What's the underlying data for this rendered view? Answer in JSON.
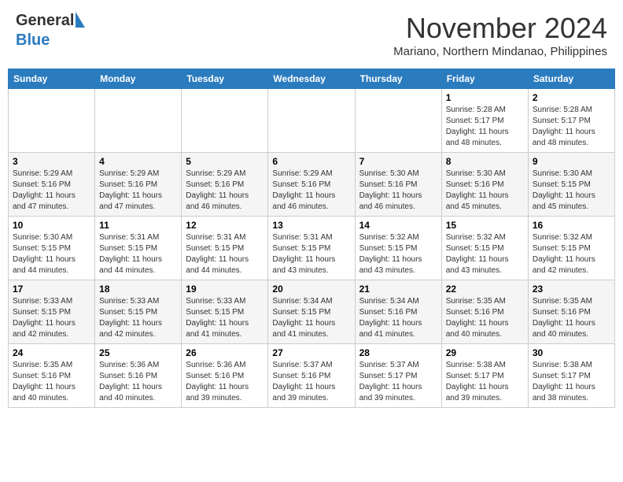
{
  "header": {
    "logo_line1": "General",
    "logo_line2": "Blue",
    "month": "November 2024",
    "location": "Mariano, Northern Mindanao, Philippines"
  },
  "weekdays": [
    "Sunday",
    "Monday",
    "Tuesday",
    "Wednesday",
    "Thursday",
    "Friday",
    "Saturday"
  ],
  "weeks": [
    [
      {
        "day": "",
        "info": ""
      },
      {
        "day": "",
        "info": ""
      },
      {
        "day": "",
        "info": ""
      },
      {
        "day": "",
        "info": ""
      },
      {
        "day": "",
        "info": ""
      },
      {
        "day": "1",
        "info": "Sunrise: 5:28 AM\nSunset: 5:17 PM\nDaylight: 11 hours\nand 48 minutes."
      },
      {
        "day": "2",
        "info": "Sunrise: 5:28 AM\nSunset: 5:17 PM\nDaylight: 11 hours\nand 48 minutes."
      }
    ],
    [
      {
        "day": "3",
        "info": "Sunrise: 5:29 AM\nSunset: 5:16 PM\nDaylight: 11 hours\nand 47 minutes."
      },
      {
        "day": "4",
        "info": "Sunrise: 5:29 AM\nSunset: 5:16 PM\nDaylight: 11 hours\nand 47 minutes."
      },
      {
        "day": "5",
        "info": "Sunrise: 5:29 AM\nSunset: 5:16 PM\nDaylight: 11 hours\nand 46 minutes."
      },
      {
        "day": "6",
        "info": "Sunrise: 5:29 AM\nSunset: 5:16 PM\nDaylight: 11 hours\nand 46 minutes."
      },
      {
        "day": "7",
        "info": "Sunrise: 5:30 AM\nSunset: 5:16 PM\nDaylight: 11 hours\nand 46 minutes."
      },
      {
        "day": "8",
        "info": "Sunrise: 5:30 AM\nSunset: 5:16 PM\nDaylight: 11 hours\nand 45 minutes."
      },
      {
        "day": "9",
        "info": "Sunrise: 5:30 AM\nSunset: 5:15 PM\nDaylight: 11 hours\nand 45 minutes."
      }
    ],
    [
      {
        "day": "10",
        "info": "Sunrise: 5:30 AM\nSunset: 5:15 PM\nDaylight: 11 hours\nand 44 minutes."
      },
      {
        "day": "11",
        "info": "Sunrise: 5:31 AM\nSunset: 5:15 PM\nDaylight: 11 hours\nand 44 minutes."
      },
      {
        "day": "12",
        "info": "Sunrise: 5:31 AM\nSunset: 5:15 PM\nDaylight: 11 hours\nand 44 minutes."
      },
      {
        "day": "13",
        "info": "Sunrise: 5:31 AM\nSunset: 5:15 PM\nDaylight: 11 hours\nand 43 minutes."
      },
      {
        "day": "14",
        "info": "Sunrise: 5:32 AM\nSunset: 5:15 PM\nDaylight: 11 hours\nand 43 minutes."
      },
      {
        "day": "15",
        "info": "Sunrise: 5:32 AM\nSunset: 5:15 PM\nDaylight: 11 hours\nand 43 minutes."
      },
      {
        "day": "16",
        "info": "Sunrise: 5:32 AM\nSunset: 5:15 PM\nDaylight: 11 hours\nand 42 minutes."
      }
    ],
    [
      {
        "day": "17",
        "info": "Sunrise: 5:33 AM\nSunset: 5:15 PM\nDaylight: 11 hours\nand 42 minutes."
      },
      {
        "day": "18",
        "info": "Sunrise: 5:33 AM\nSunset: 5:15 PM\nDaylight: 11 hours\nand 42 minutes."
      },
      {
        "day": "19",
        "info": "Sunrise: 5:33 AM\nSunset: 5:15 PM\nDaylight: 11 hours\nand 41 minutes."
      },
      {
        "day": "20",
        "info": "Sunrise: 5:34 AM\nSunset: 5:15 PM\nDaylight: 11 hours\nand 41 minutes."
      },
      {
        "day": "21",
        "info": "Sunrise: 5:34 AM\nSunset: 5:16 PM\nDaylight: 11 hours\nand 41 minutes."
      },
      {
        "day": "22",
        "info": "Sunrise: 5:35 AM\nSunset: 5:16 PM\nDaylight: 11 hours\nand 40 minutes."
      },
      {
        "day": "23",
        "info": "Sunrise: 5:35 AM\nSunset: 5:16 PM\nDaylight: 11 hours\nand 40 minutes."
      }
    ],
    [
      {
        "day": "24",
        "info": "Sunrise: 5:35 AM\nSunset: 5:16 PM\nDaylight: 11 hours\nand 40 minutes."
      },
      {
        "day": "25",
        "info": "Sunrise: 5:36 AM\nSunset: 5:16 PM\nDaylight: 11 hours\nand 40 minutes."
      },
      {
        "day": "26",
        "info": "Sunrise: 5:36 AM\nSunset: 5:16 PM\nDaylight: 11 hours\nand 39 minutes."
      },
      {
        "day": "27",
        "info": "Sunrise: 5:37 AM\nSunset: 5:16 PM\nDaylight: 11 hours\nand 39 minutes."
      },
      {
        "day": "28",
        "info": "Sunrise: 5:37 AM\nSunset: 5:17 PM\nDaylight: 11 hours\nand 39 minutes."
      },
      {
        "day": "29",
        "info": "Sunrise: 5:38 AM\nSunset: 5:17 PM\nDaylight: 11 hours\nand 39 minutes."
      },
      {
        "day": "30",
        "info": "Sunrise: 5:38 AM\nSunset: 5:17 PM\nDaylight: 11 hours\nand 38 minutes."
      }
    ]
  ]
}
